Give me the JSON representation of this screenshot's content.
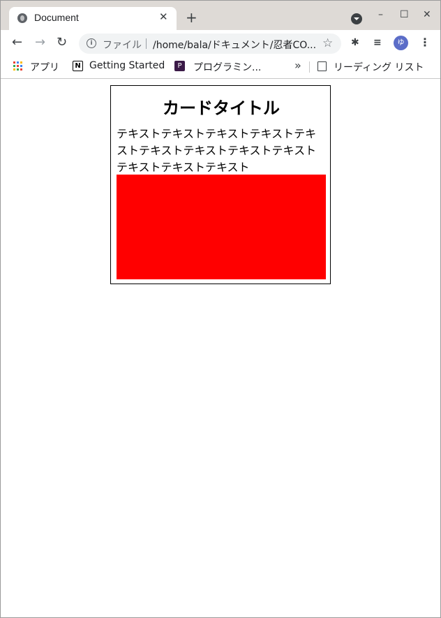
{
  "tab": {
    "title": "Document",
    "close": "✕",
    "favicon": "globe-icon"
  },
  "newtab": "+",
  "window_controls": {
    "minimize": "–",
    "maximize": "☐",
    "close": "✕"
  },
  "nav": {
    "back": "←",
    "forward": "→",
    "reload": "↻"
  },
  "omnibox": {
    "info": "i",
    "scheme_label": "ファイル",
    "url": "/home/bala/ドキュメント/忍者CO...",
    "star": "☆"
  },
  "extensions": {
    "puzzle": "✱",
    "media": "≡",
    "avatar": "ゆ",
    "menu": "⋮"
  },
  "bookmarks": {
    "apps": "アプリ",
    "getting_started": "Getting Started",
    "notion_glyph": "N",
    "programming": "プログラミン...",
    "p_glyph": "P",
    "more": "»",
    "reading_list": "リーディング リスト"
  },
  "card": {
    "title": "カードタイトル",
    "text": "テキストテキストテキストテキストテキストテキストテキストテキストテキストテキストテキストテキスト",
    "box_color": "#ff0000"
  }
}
